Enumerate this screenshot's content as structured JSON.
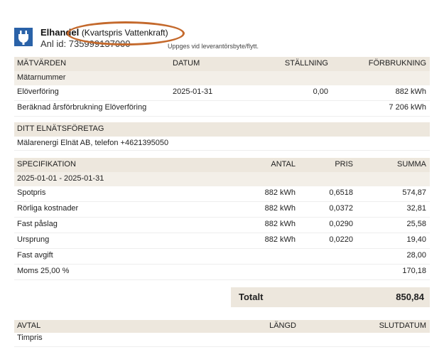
{
  "header": {
    "title": "Elhandel",
    "subtitle": "(Kvartspris Vattenkraft)",
    "anl_id": "Anl id: 735999137000",
    "note": "Uppges vid leverantörsbyte/flytt.",
    "icon": "plug-icon",
    "accent": "#2a62a8",
    "highlight": "#c4692c"
  },
  "matvarden": {
    "headers": [
      "MÄTVÄRDEN",
      "DATUM",
      "STÄLLNING",
      "FÖRBRUKNING"
    ],
    "group": "Mätarnummer",
    "rows": [
      [
        "Elöverföring",
        "2025-01-31",
        "0,00",
        "882 kWh"
      ]
    ],
    "estimate": {
      "label": "Beräknad årsförbrukning Elöverföring",
      "value": "7 206 kWh"
    }
  },
  "natforetag": {
    "header": "DITT ELNÄTSFÖRETAG",
    "value": "Mälarenergi Elnät AB, telefon +4621395050"
  },
  "spec": {
    "headers": [
      "SPECIFIKATION",
      "ANTAL",
      "PRIS",
      "SUMMA"
    ],
    "period": "2025-01-01 - 2025-01-31",
    "rows": [
      [
        "Spotpris",
        "882 kWh",
        "0,6518",
        "574,87"
      ],
      [
        "Rörliga kostnader",
        "882 kWh",
        "0,0372",
        "32,81"
      ],
      [
        "Fast påslag",
        "882 kWh",
        "0,0290",
        "25,58"
      ],
      [
        "Ursprung",
        "882 kWh",
        "0,0220",
        "19,40"
      ],
      [
        "Fast avgift",
        "",
        "",
        "28,00"
      ],
      [
        "Moms 25,00 %",
        "",
        "",
        "170,18"
      ]
    ]
  },
  "total": {
    "label": "Totalt",
    "value": "850,84"
  },
  "avtal": {
    "headers": [
      "AVTAL",
      "LÄNGD",
      "SLUTDATUM"
    ],
    "value": "Timpris"
  }
}
